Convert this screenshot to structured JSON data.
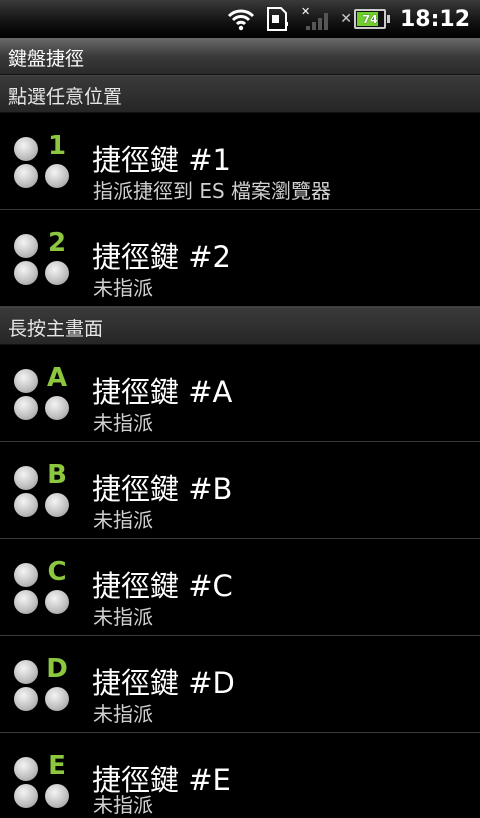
{
  "status_bar": {
    "time": "18:12",
    "battery_level": "74",
    "battery_percent": 74,
    "icons": [
      "wifi-icon",
      "sd-card-icon",
      "signal-icon",
      "battery-icon"
    ]
  },
  "title_bar": {
    "title": "鍵盤捷徑"
  },
  "sections": [
    {
      "header": "點選任意位置"
    },
    {
      "header": "長按主畫面"
    }
  ],
  "rows": [
    {
      "key": "1",
      "title": "捷徑鍵 #1",
      "subtitle": "指派捷徑到 ES 檔案瀏覽器"
    },
    {
      "key": "2",
      "title": "捷徑鍵 #2",
      "subtitle": "未指派"
    },
    {
      "key": "A",
      "title": "捷徑鍵 #A",
      "subtitle": "未指派"
    },
    {
      "key": "B",
      "title": "捷徑鍵 #B",
      "subtitle": "未指派"
    },
    {
      "key": "C",
      "title": "捷徑鍵 #C",
      "subtitle": "未指派"
    },
    {
      "key": "D",
      "title": "捷徑鍵 #D",
      "subtitle": "未指派"
    },
    {
      "key": "E",
      "title": "捷徑鍵 #E",
      "subtitle": "未指派"
    }
  ],
  "colors": {
    "key_label": "#8dc63f",
    "background": "#000000"
  }
}
